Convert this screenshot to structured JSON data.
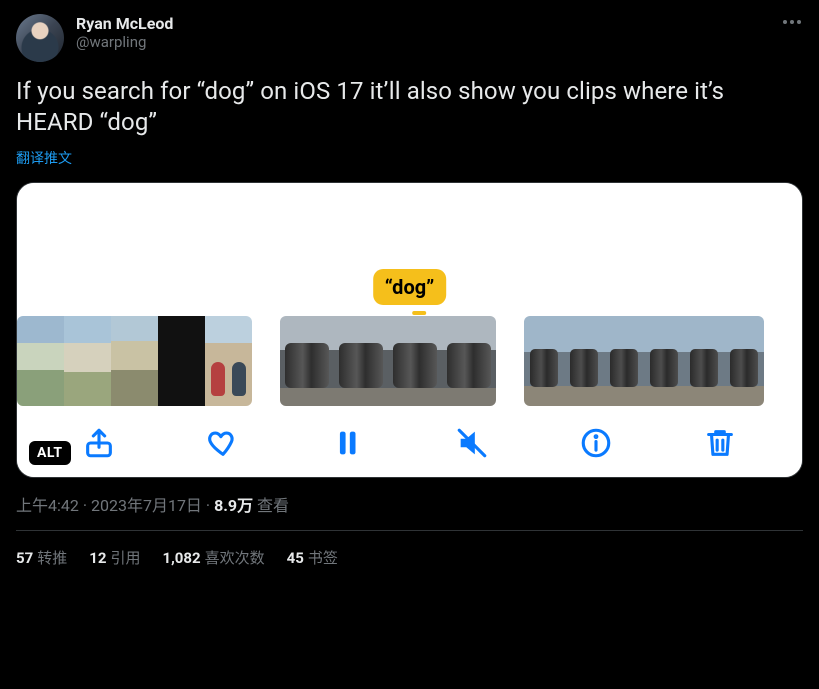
{
  "author": {
    "display_name": "Ryan McLeod",
    "handle": "@warpling"
  },
  "body": "If you search for “dog” on iOS 17 it’ll also show you clips where it’s HEARD “dog”",
  "translate_label": "翻译推文",
  "media": {
    "search_term_tag": "“dog”",
    "alt_badge": "ALT"
  },
  "meta": {
    "time": "上午4:42",
    "dot1": " · ",
    "date": "2023年7月17日",
    "dot2": " · ",
    "views_count": "8.9万",
    "views_label": " 查看"
  },
  "stats": {
    "retweets_count": "57",
    "retweets_label": "转推",
    "quotes_count": "12",
    "quotes_label": "引用",
    "likes_count": "1,082",
    "likes_label": "喜欢次数",
    "bookmarks_count": "45",
    "bookmarks_label": "书签"
  }
}
